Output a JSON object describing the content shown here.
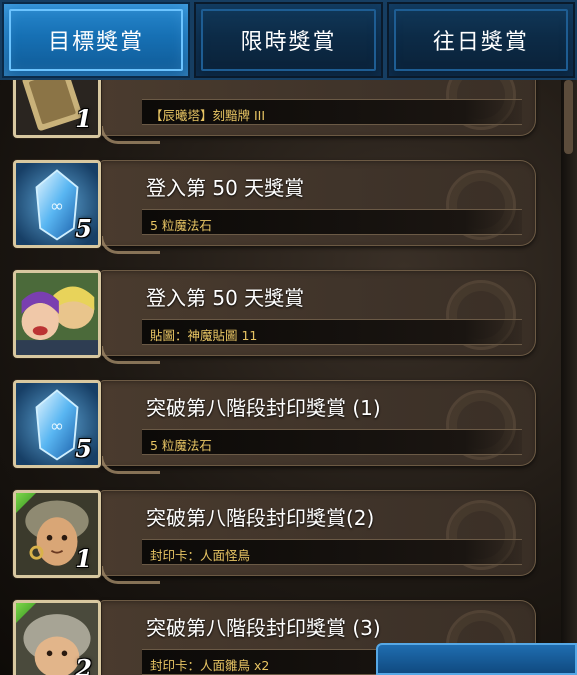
{
  "tabs": [
    {
      "label": "目標獎賞",
      "active": true
    },
    {
      "label": "限時獎賞",
      "active": false
    },
    {
      "label": "往日獎賞",
      "active": false
    }
  ],
  "rewards": [
    {
      "title": "",
      "item": "【辰曦塔】刻黯牌 III",
      "count": "1",
      "icon": "card-icon"
    },
    {
      "title": "登入第 50 天獎賞",
      "item": "5 粒魔法石",
      "count": "5",
      "icon": "magic-stone-icon"
    },
    {
      "title": "登入第 50 天獎賞",
      "item": "貼圖：神魔貼圖 11",
      "count": "",
      "icon": "sticker-icon"
    },
    {
      "title": "突破第八階段封印獎賞 (1)",
      "item": "5 粒魔法石",
      "count": "5",
      "icon": "magic-stone-icon"
    },
    {
      "title": "突破第八階段封印獎賞(2)",
      "item": "封印卡：人面怪鳥",
      "count": "1",
      "icon": "harpy-card-icon"
    },
    {
      "title": "突破第八階段封印獎賞 (3)",
      "item": "封印卡：人面雛鳥 x2",
      "count": "2",
      "icon": "chick-card-icon"
    }
  ],
  "colors": {
    "tab_active": "#1670b4",
    "tab_inactive": "#0c2b47",
    "desc_text": "#e7c463",
    "panel": "#40342a"
  }
}
